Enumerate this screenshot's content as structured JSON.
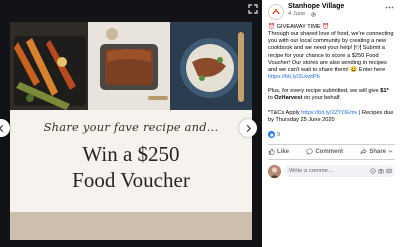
{
  "viewer": {
    "headline_script": "Share your fave recipe and...",
    "headline_line1": "Win a $250",
    "headline_line2": "Food Voucher"
  },
  "post": {
    "page_name": "Stanhope Village",
    "date": "4 June",
    "paragraph1": {
      "emoji_start": "⏰",
      "title": "GIVEAWAY TIME",
      "emoji_end": "⏰",
      "text_a": "Through our shared love of food, we're connecting you with our local community by creating a new cookbook and we need your help! 🍽 Submit a recipe for your chance to score a $250 Food Voucher! Our stores are also sending in recipes and we can't wait to share them! 😀 Enter here",
      "link": "https://bit.ly/2LkwtPb"
    },
    "paragraph2": {
      "text_a": "Plus, for every recipe submitted, we will give",
      "amount": "$1*",
      "text_b": "to",
      "org": "OzHarvest",
      "text_c": "on your behalf."
    },
    "paragraph3": {
      "text_a": "*T&Cs Apply",
      "link": "https://bit.ly/2ZYOEmv",
      "text_b": "| Recipes due by Thursday 25 June 2020"
    },
    "reaction_count": "9",
    "actions": {
      "like": "Like",
      "comment": "Comment",
      "share": "Share"
    },
    "comment_placeholder": "Write a comme..."
  },
  "colors": {
    "viewer_bg": "#111316",
    "link": "#216fdb",
    "like_blue": "#1877f2",
    "secondary_text": "#65676b"
  },
  "icons": [
    "chevron-left-icon",
    "chevron-right-icon",
    "fullscreen-icon",
    "globe-icon",
    "more-icon",
    "like-icon",
    "comment-icon",
    "share-icon",
    "emoji-icon",
    "camera-icon",
    "gif-icon"
  ]
}
